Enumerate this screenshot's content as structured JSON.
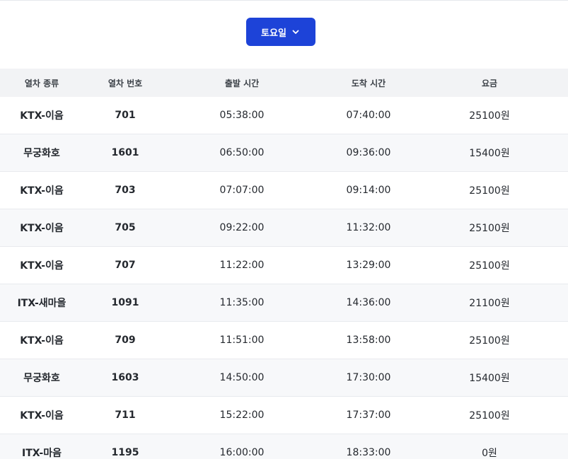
{
  "day_selector": {
    "label": "토요일",
    "icon": "chevron-down-icon"
  },
  "colors": {
    "accent": "#1d43d8",
    "header_bg": "#f2f3f5",
    "alt_row_bg": "#f7f8fa"
  },
  "table": {
    "headers": [
      "열차 종류",
      "열차 번호",
      "출발 시간",
      "도착 시간",
      "요금"
    ],
    "rows": [
      {
        "type": "KTX-이음",
        "number": "701",
        "depart": "05:38:00",
        "arrive": "07:40:00",
        "fare": "25100원"
      },
      {
        "type": "무궁화호",
        "number": "1601",
        "depart": "06:50:00",
        "arrive": "09:36:00",
        "fare": "15400원"
      },
      {
        "type": "KTX-이음",
        "number": "703",
        "depart": "07:07:00",
        "arrive": "09:14:00",
        "fare": "25100원"
      },
      {
        "type": "KTX-이음",
        "number": "705",
        "depart": "09:22:00",
        "arrive": "11:32:00",
        "fare": "25100원"
      },
      {
        "type": "KTX-이음",
        "number": "707",
        "depart": "11:22:00",
        "arrive": "13:29:00",
        "fare": "25100원"
      },
      {
        "type": "ITX-새마을",
        "number": "1091",
        "depart": "11:35:00",
        "arrive": "14:36:00",
        "fare": "21100원"
      },
      {
        "type": "KTX-이음",
        "number": "709",
        "depart": "11:51:00",
        "arrive": "13:58:00",
        "fare": "25100원"
      },
      {
        "type": "무궁화호",
        "number": "1603",
        "depart": "14:50:00",
        "arrive": "17:30:00",
        "fare": "15400원"
      },
      {
        "type": "KTX-이음",
        "number": "711",
        "depart": "15:22:00",
        "arrive": "17:37:00",
        "fare": "25100원"
      },
      {
        "type": "ITX-마음",
        "number": "1195",
        "depart": "16:00:00",
        "arrive": "18:33:00",
        "fare": "0원"
      }
    ]
  }
}
